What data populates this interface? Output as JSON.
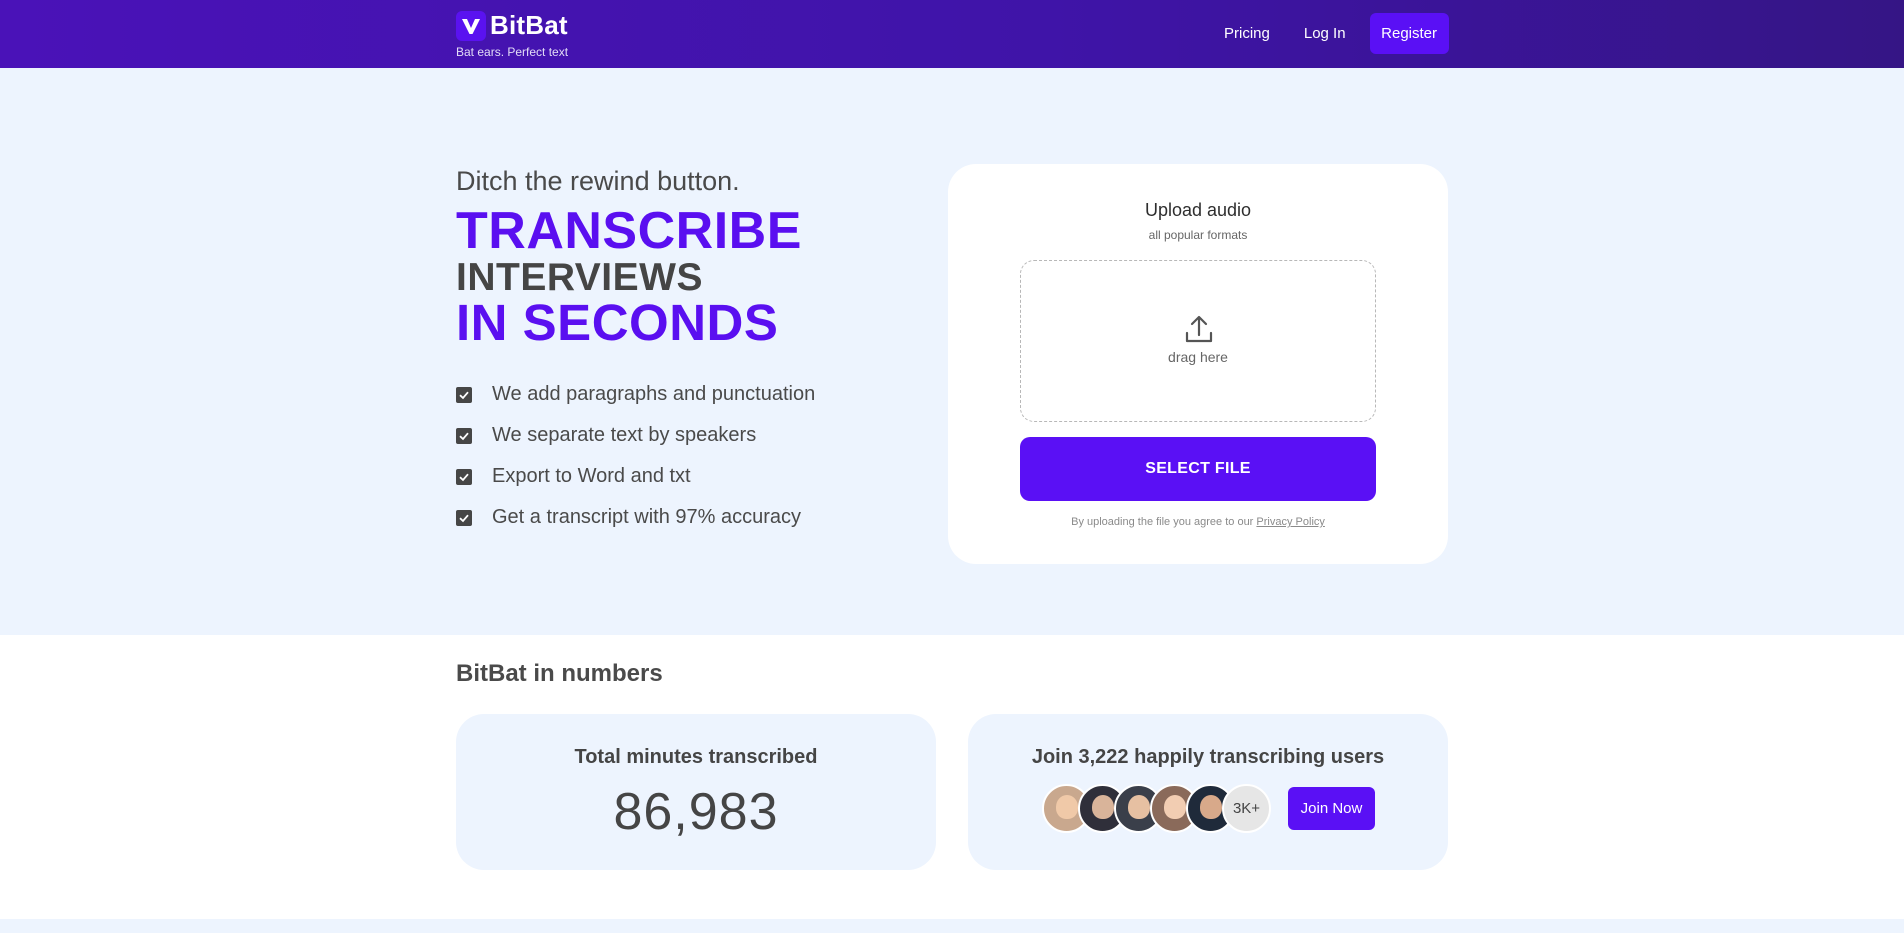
{
  "header": {
    "brand_name": "BitBat",
    "tagline": "Bat ears. Perfect text",
    "nav": {
      "pricing": "Pricing",
      "login": "Log In",
      "register": "Register"
    }
  },
  "hero": {
    "subheading": "Ditch the rewind button.",
    "headline_line1": "TRANSCRIBE",
    "headline_line2": "INTERVIEWS",
    "headline_line3": "IN SECONDS",
    "features": [
      "We add paragraphs and punctuation",
      "We separate text by speakers",
      "Export to Word and txt",
      "Get a transcript with 97% accuracy"
    ]
  },
  "upload": {
    "title": "Upload audio",
    "subtitle": "all popular formats",
    "drag_text": "drag here",
    "select_label": "SELECT FILE",
    "consent_text": "By uploading the file you agree to our",
    "privacy_link": "Privacy Policy"
  },
  "numbers": {
    "title": "BitBat in numbers",
    "minutes_label": "Total minutes transcribed",
    "minutes_value": "86,983",
    "users_label": "Join 3,222 happily transcribing users",
    "more_users": "3K+",
    "join_label": "Join Now"
  },
  "icons": {
    "logo": "bat-v-logo-icon",
    "check": "checkbox-checked-icon",
    "upload": "upload-arrow-icon"
  },
  "colors": {
    "accent": "#5a10f5",
    "header_start": "#4a12b8",
    "header_end": "#351585",
    "hero_bg": "#edf4fe",
    "text_dark": "#474747"
  }
}
